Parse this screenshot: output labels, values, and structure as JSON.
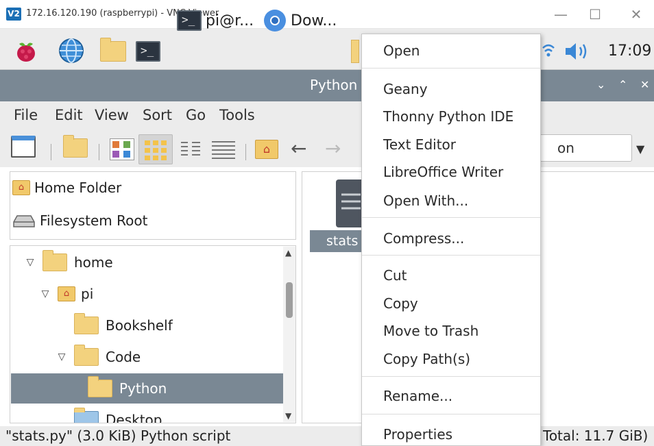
{
  "vnc": {
    "logo": "V2",
    "title": "172.16.120.190 (raspberrypi) - VNC Viewer",
    "controls": {
      "minimize": "—",
      "maximize": "☐",
      "close": "✕"
    }
  },
  "panel": {
    "tasks": [
      {
        "label": "pi@r..."
      },
      {
        "label": "Dow..."
      }
    ],
    "clock": "17:09"
  },
  "file_manager": {
    "title": "Python",
    "controls": {
      "minimize": "⌄",
      "maximize": "⌃",
      "close": "✕"
    },
    "menus": [
      "File",
      "Edit",
      "View",
      "Sort",
      "Go",
      "Tools"
    ],
    "path_value": "on",
    "places": [
      {
        "label": "Home Folder",
        "icon": "home-folder-icon"
      },
      {
        "label": "Filesystem Root",
        "icon": "drive-icon"
      }
    ],
    "tree": [
      {
        "label": "home",
        "expander": "▽"
      },
      {
        "label": "pi",
        "expander": "▽"
      },
      {
        "label": "Bookshelf",
        "expander": ""
      },
      {
        "label": "Code",
        "expander": "▽"
      },
      {
        "label": "Python",
        "expander": ""
      },
      {
        "label": "Desktop",
        "expander": ""
      }
    ],
    "selected_tree_item": "Python",
    "file_label": "stats",
    "status_left": "\"stats.py\" (3.0 KiB) Python script",
    "status_right": "Total: 11.7 GiB)"
  },
  "context_menu": {
    "items": [
      "Open",
      "Geany",
      "Thonny Python IDE",
      "Text Editor",
      "LibreOffice Writer",
      "Open With...",
      "Compress...",
      "Cut",
      "Copy",
      "Move to Trash",
      "Copy Path(s)",
      "Rename...",
      "Properties"
    ]
  },
  "colors": {
    "selection": "#7a8894",
    "panel": "#ececec",
    "folder": "#f3d27e"
  }
}
